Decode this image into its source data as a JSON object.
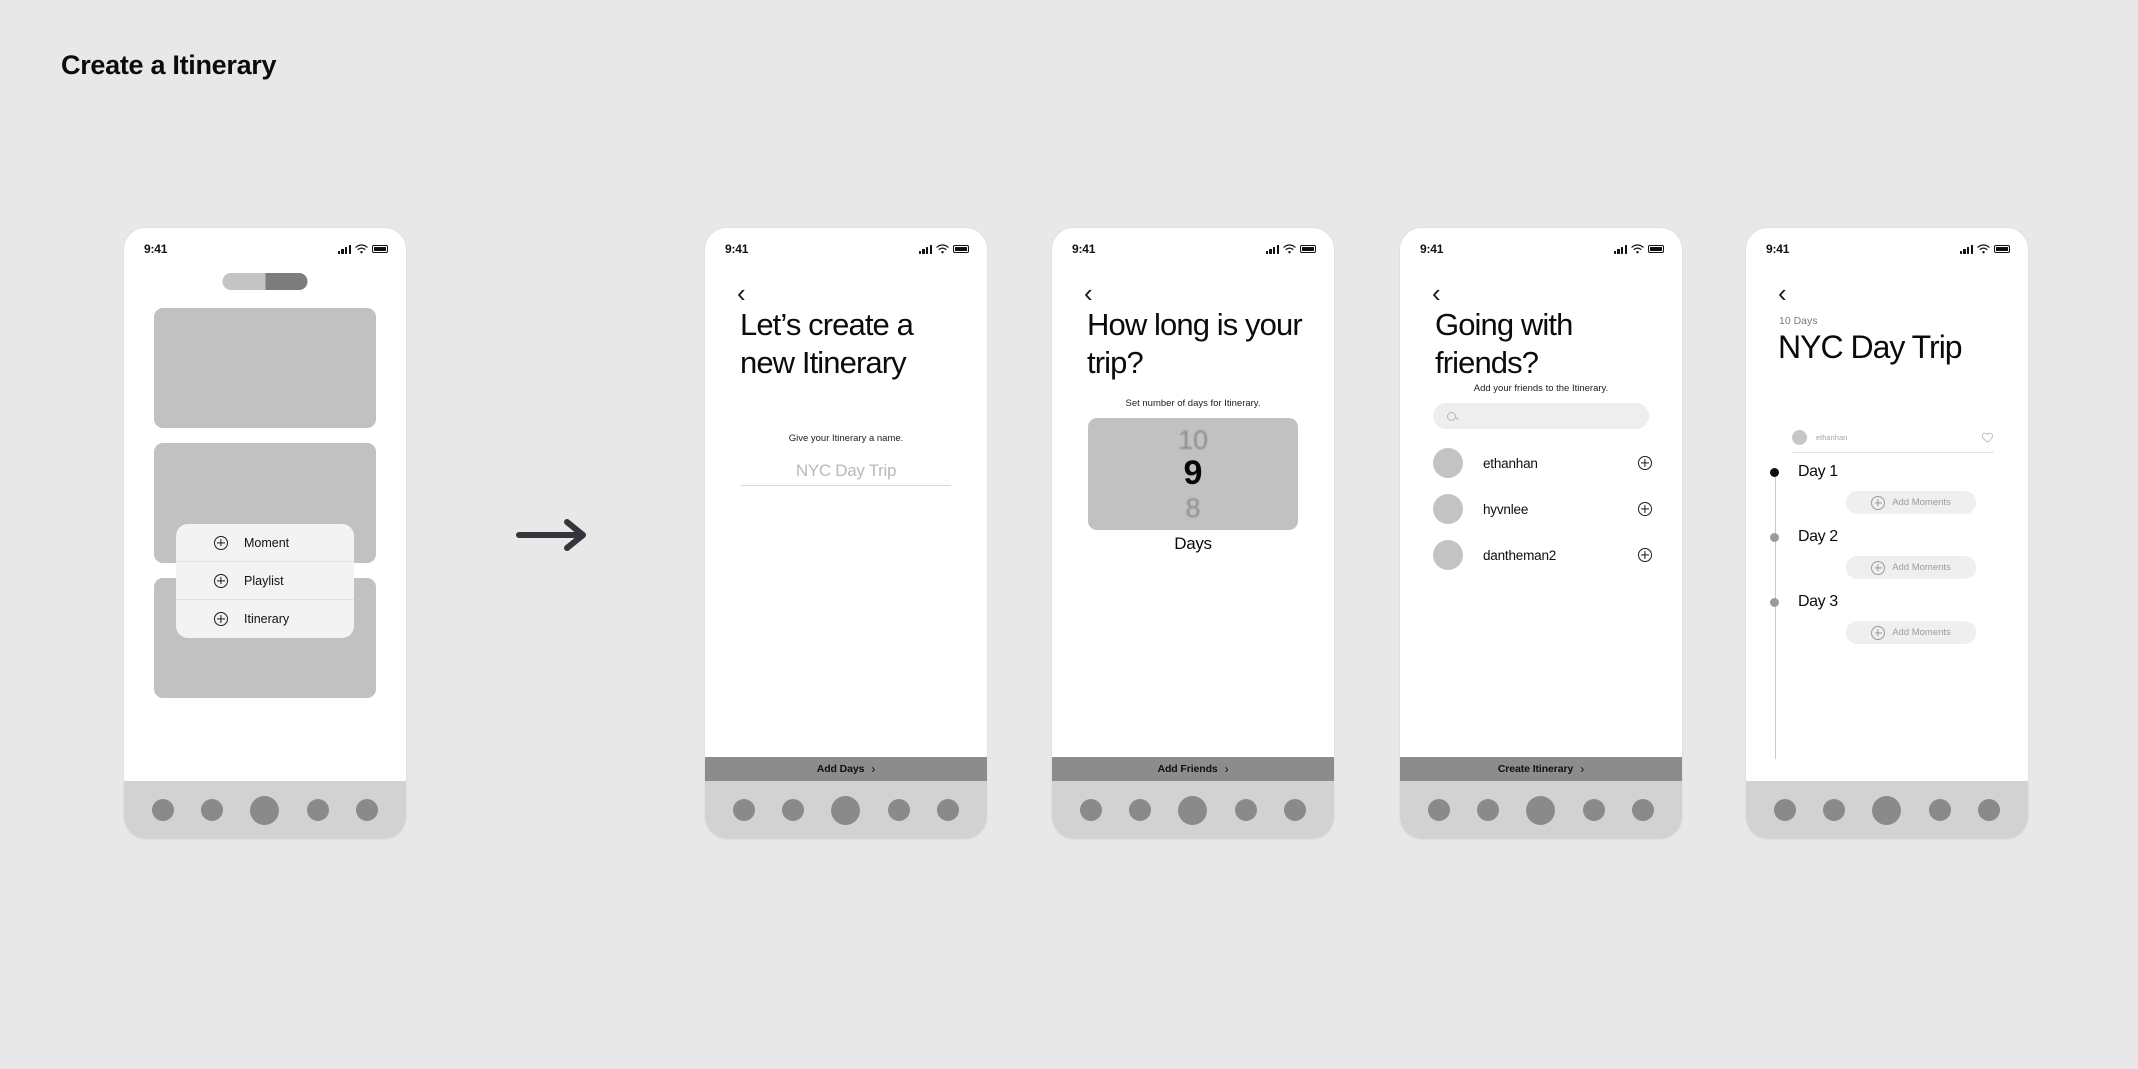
{
  "page": {
    "title": "Create a Itinerary",
    "background": "#e8e8e8",
    "arrow": "arrow-right"
  },
  "status_bar": {
    "time": "9:41",
    "icons": [
      "cellular-signal-icon",
      "wifi-icon",
      "battery-icon"
    ]
  },
  "screens": [
    {
      "id": "phone-1",
      "name": "home-with-create-menu",
      "toggle": {
        "name": "segmented-toggle",
        "selected": "right"
      },
      "cards": [
        "placeholder-card",
        "placeholder-card",
        "placeholder-card"
      ],
      "popup_menu": {
        "items": [
          {
            "icon": "plus-circle-icon",
            "label": "Moment"
          },
          {
            "icon": "plus-circle-icon",
            "label": "Playlist"
          },
          {
            "icon": "plus-circle-icon",
            "label": "Itinerary"
          }
        ]
      }
    },
    {
      "id": "phone-2",
      "name": "name-itinerary",
      "back_icon": "chevron-left-icon",
      "headline": "Let’s create a new Itinerary",
      "subtitle": "Give your Itinerary a name.",
      "input": {
        "value": "",
        "placeholder": "NYC Day Trip"
      },
      "cta": {
        "label": "Add Days",
        "chevron": "chevron-right-icon"
      }
    },
    {
      "id": "phone-3",
      "name": "trip-length",
      "back_icon": "chevron-left-icon",
      "headline": "How long is your trip?",
      "subtitle": "Set number of days for Itinerary.",
      "picker": {
        "above": "10",
        "selected": "9",
        "below": "8",
        "unit": "Days"
      },
      "cta": {
        "label": "Add Friends",
        "chevron": "chevron-right-icon"
      }
    },
    {
      "id": "phone-4",
      "name": "add-friends",
      "back_icon": "chevron-left-icon",
      "headline": "Going with friends?",
      "subtitle": "Add your friends to the Itinerary.",
      "search": {
        "value": "",
        "placeholder": "",
        "icon": "search-icon"
      },
      "friends": [
        {
          "username": "ethanhan",
          "action_icon": "plus-circle-icon"
        },
        {
          "username": "hyvnlee",
          "action_icon": "plus-circle-icon"
        },
        {
          "username": "dantheman2",
          "action_icon": "plus-circle-icon"
        }
      ],
      "cta": {
        "label": "Create Itinerary",
        "chevron": "chevron-right-icon"
      }
    },
    {
      "id": "phone-5",
      "name": "itinerary-detail",
      "back_icon": "chevron-left-icon",
      "meta": "10 Days",
      "title": "NYC Day Trip",
      "owner": {
        "username": "ethanhan",
        "like_icon": "heart-icon"
      },
      "days": [
        {
          "label": "Day 1",
          "button": "Add Moments",
          "button_icon": "plus-circle-icon"
        },
        {
          "label": "Day 2",
          "button": "Add Moments",
          "button_icon": "plus-circle-icon"
        },
        {
          "label": "Day 3",
          "button": "Add Moments",
          "button_icon": "plus-circle-icon"
        }
      ]
    }
  ],
  "tab_bar": {
    "items": [
      "tab-1",
      "tab-2",
      "tab-3",
      "tab-4",
      "tab-5"
    ]
  }
}
